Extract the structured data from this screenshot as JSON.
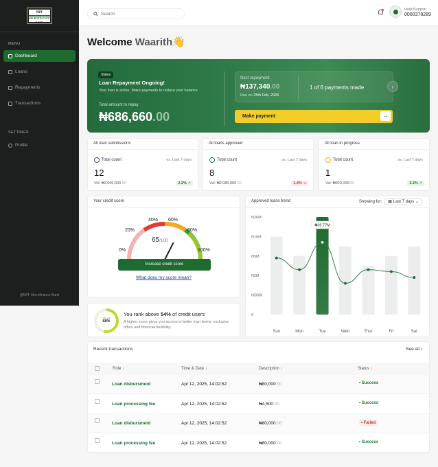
{
  "sidebar": {
    "logo_text": "NPF",
    "logo_sub": "MICROFINANCE BANK",
    "menu_heading": "MENU",
    "items": [
      {
        "label": "Dashboard",
        "active": true
      },
      {
        "label": "Loans",
        "active": false
      },
      {
        "label": "Repayments",
        "active": false
      },
      {
        "label": "Transactions",
        "active": false
      }
    ],
    "settings_heading": "SETTINGS",
    "settings_items": [
      {
        "label": "Profile"
      }
    ],
    "footer": "@NPF Microfinance Bank"
  },
  "topbar": {
    "search_placeholder": "Search",
    "help_label": "Help/Support",
    "help_phone": "0000378289"
  },
  "welcome": {
    "greeting": "Welcome",
    "name": "Waarith",
    "emoji": "👋"
  },
  "hero": {
    "status_badge": "Status",
    "title": "Loan Repayment Ongoing!",
    "subtitle": "Your loan is active. Make payments to reduce your balance",
    "total_label": "Total amount to repay",
    "total_main": "₦686,660",
    "total_dec": ".00",
    "next_label": "Next repayment",
    "next_main": "₦137,340",
    "next_dec": ".00",
    "due_label": "Due on",
    "due_date": "25th Feb, 2026",
    "payments_progress": "1 of 6 payments made",
    "make_payment": "Make payment",
    "accent": "#f3cd28"
  },
  "stats": [
    {
      "title": "All loan submissions",
      "count_label": "Total count",
      "period": "vs. Last 7 days",
      "value": "12",
      "vol_label": "Vol:",
      "vol_main": "₦3,000,000",
      "vol_dec": ".00",
      "change": "2.2%",
      "change_arrow": "↗",
      "trend": "up",
      "icon_color": "#3949ab"
    },
    {
      "title": "All loans approved",
      "count_label": "Total count",
      "period": "vs. Last 7 days",
      "value": "8",
      "vol_label": "Vol:",
      "vol_main": "₦2,080,000",
      "vol_dec": ".00",
      "change": "1.4%",
      "change_arrow": "↘",
      "trend": "down",
      "icon_color": "#1e7a35"
    },
    {
      "title": "All loan in progress",
      "count_label": "Total count",
      "period": "vs. Last 7 days",
      "value": "1",
      "vol_label": "Vol:",
      "vol_main": "₦920,000",
      "vol_dec": ".00",
      "change": "2.2%",
      "change_arrow": "↗",
      "trend": "up",
      "icon_color": "#f9a825"
    }
  ],
  "credit": {
    "title": "Your credit score",
    "score": "65",
    "max": "/100",
    "score_value": 65,
    "ticks": [
      "0%",
      "20%",
      "40%",
      "60%",
      "80%",
      "100%"
    ],
    "button": "Increase credit score",
    "link": "What does my score mean?"
  },
  "rank": {
    "ring_label": "You rank",
    "percent": "68%",
    "percent_value": 54,
    "title_pre": "You rank above ",
    "title_bold": "54%",
    "title_post": " of credit users",
    "subtitle": "A higher score gives you access to better loan terms, exclusive offers and financial flexibility."
  },
  "trend": {
    "title": "Approved loans trend",
    "showing_label": "Showing for:",
    "showing_value": "Last 7 days",
    "tooltip": "₦39.77M"
  },
  "chart_data": {
    "type": "bar",
    "title": "Approved loans trend",
    "categories": [
      "Sun",
      "Mon",
      "Tue",
      "Wed",
      "Thur",
      "Fri",
      "Sat"
    ],
    "y_ticks": [
      "0",
      "N500K",
      "N2M",
      "N5M",
      "N10M",
      "N20M"
    ],
    "bar_levels": [
      4,
      3,
      5,
      3.5,
      2.5,
      3,
      3.5
    ],
    "line_levels": [
      2.9,
      2.3,
      3.7,
      1.6,
      2.3,
      2.2,
      1.9
    ],
    "highlight_index": 2,
    "highlight_label": "₦39.77M"
  },
  "transactions": {
    "title": "Recent transactions",
    "see_all": "See all",
    "columns": [
      "Role",
      "Time & Date",
      "Description",
      "Status"
    ],
    "rows": [
      {
        "role": "Loan disbursment",
        "time": "Apr 12, 2025, 14:02:52",
        "desc_main": "₦80,000",
        "desc_dec": ".00",
        "status": "Success"
      },
      {
        "role": "Loan processing fee",
        "time": "Apr 12, 2025, 14:02:52",
        "desc_main": "₦4,500",
        "desc_dec": ".00",
        "status": "Success"
      },
      {
        "role": "Loan disbursment",
        "time": "Apr 12, 2025, 14:02:52",
        "desc_main": "₦80,000",
        "desc_dec": ".00",
        "status": "Failed"
      },
      {
        "role": "Loan processing fee",
        "time": "Apr 12, 2025, 14:02:52",
        "desc_main": "₦80,000",
        "desc_dec": ".00",
        "status": "Success"
      }
    ]
  }
}
